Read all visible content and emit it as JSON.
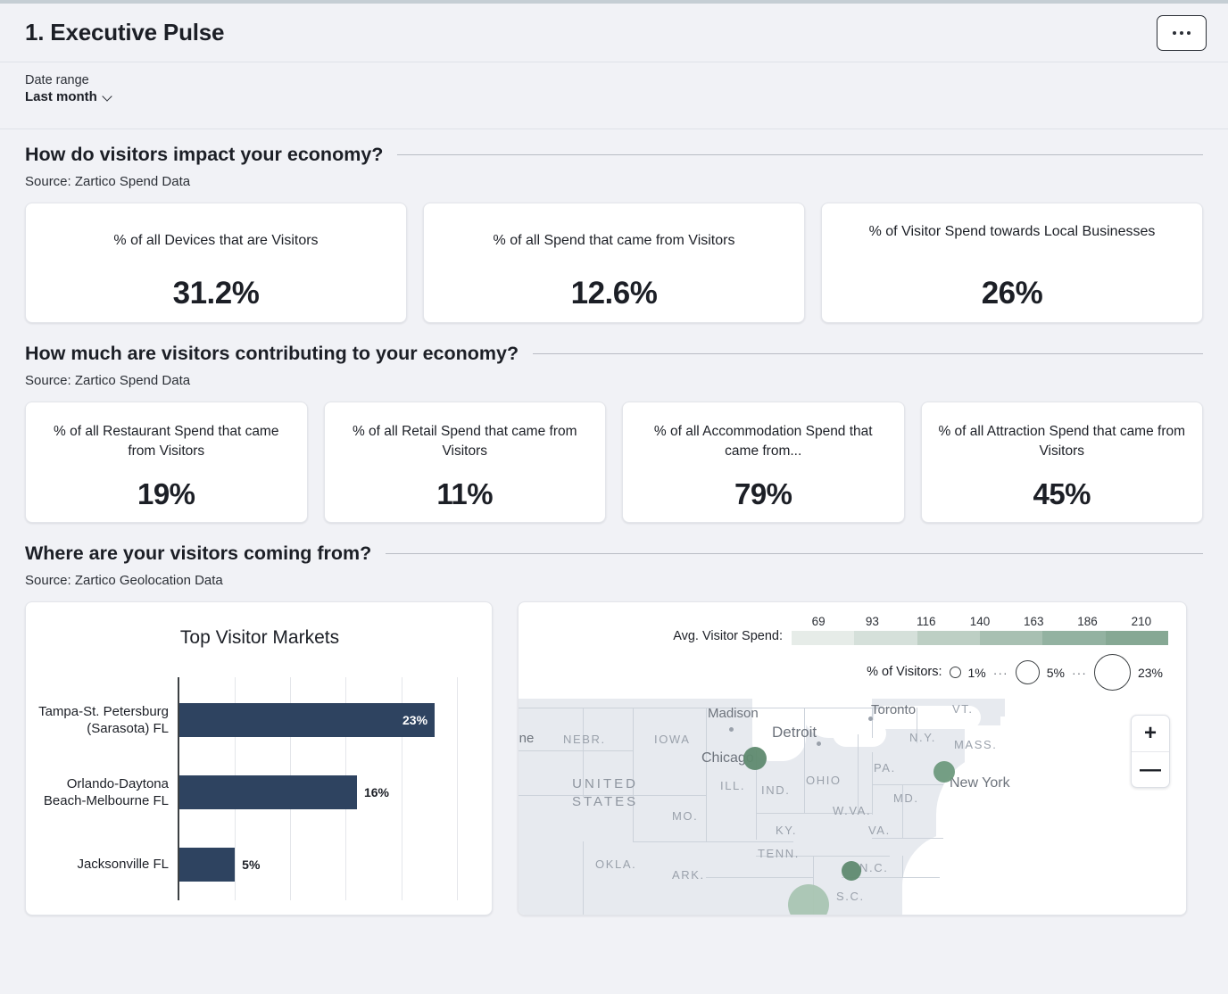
{
  "header": {
    "title": "1. Executive Pulse",
    "more_icon": "ellipsis-icon"
  },
  "filter": {
    "label": "Date range",
    "value": "Last month",
    "chevron_icon": "chevron-down-icon"
  },
  "sections": [
    {
      "title": "How do visitors impact your economy?",
      "source": "Source: Zartico Spend Data",
      "cards": [
        {
          "label": "% of all Devices that are Visitors",
          "value": "31.2%"
        },
        {
          "label": "% of all Spend that came from Visitors",
          "value": "12.6%"
        },
        {
          "label": "% of Visitor Spend towards Local Businesses",
          "value": "26%"
        }
      ]
    },
    {
      "title": "How much are visitors contributing to your economy?",
      "source": "Source: Zartico Spend Data",
      "cards": [
        {
          "label": "% of all Restaurant Spend that came from Visitors",
          "value": "19%"
        },
        {
          "label": "% of all Retail Spend that came from Visitors",
          "value": "11%"
        },
        {
          "label": "% of all Accommodation Spend that came from...",
          "value": "79%"
        },
        {
          "label": "% of all Attraction Spend that came from Visitors",
          "value": "45%"
        }
      ]
    },
    {
      "title": "Where are your visitors coming from?",
      "source": "Source: Zartico Geolocation Data"
    }
  ],
  "map_legend": {
    "spend_label": "Avg. Visitor Spend:",
    "spend_ticks": [
      "69",
      "93",
      "116",
      "140",
      "163",
      "186",
      "210"
    ],
    "spend_colors": [
      "#e6ece8",
      "#d5e0da",
      "#bdcfc4",
      "#a8c0b2",
      "#93b2a1",
      "#86a894"
    ],
    "visitors_label": "% of Visitors:",
    "visitors_small": "1%",
    "visitors_mid": "5%",
    "visitors_large": "23%",
    "ellipsis": "···"
  },
  "map": {
    "zoom_in": "+",
    "zoom_out": "—",
    "country_label": "UNITED\nSTATES",
    "states": [
      "NEBR.",
      "IOWA",
      "ILL.",
      "IND.",
      "OHIO",
      "W.VA.",
      "PA.",
      "N.Y.",
      "VT.",
      "MASS.",
      "MD.",
      "VA.",
      "KY.",
      "MO.",
      "TENN.",
      "OKLA.",
      "ARK.",
      "N.C.",
      "S.C."
    ],
    "cities": [
      "Madison",
      "Detroit",
      "Chicago",
      "Toronto",
      "New York",
      "enne"
    ]
  },
  "chart_data": {
    "type": "bar",
    "orientation": "horizontal",
    "title": "Top Visitor Markets",
    "categories": [
      "Tampa-St. Petersburg (Sarasota) FL",
      "Orlando-Daytona Beach-Melbourne FL",
      "Jacksonville FL"
    ],
    "values": [
      23,
      16,
      5
    ],
    "value_labels": [
      "23%",
      "16%",
      "5%"
    ],
    "xlabel": "",
    "ylabel": "",
    "xlim": [
      0,
      27.5
    ],
    "grid": true,
    "series_color": "#2e4360"
  }
}
